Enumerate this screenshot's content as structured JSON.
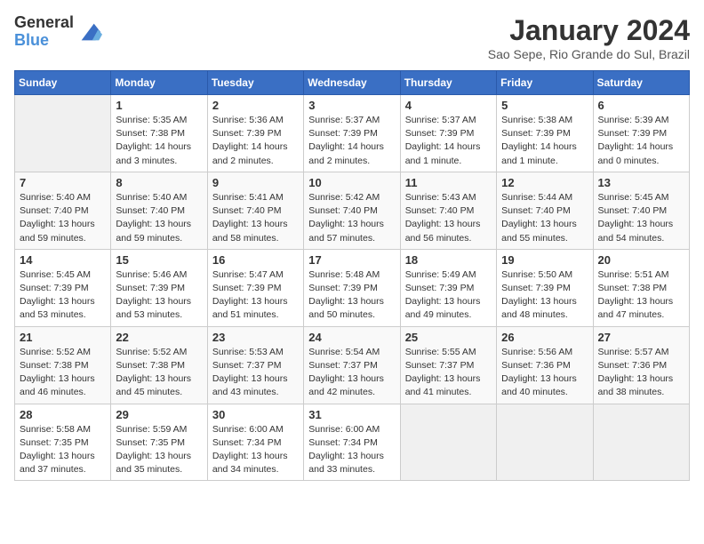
{
  "logo": {
    "general": "General",
    "blue": "Blue"
  },
  "title": "January 2024",
  "subtitle": "Sao Sepe, Rio Grande do Sul, Brazil",
  "days_of_week": [
    "Sunday",
    "Monday",
    "Tuesday",
    "Wednesday",
    "Thursday",
    "Friday",
    "Saturday"
  ],
  "weeks": [
    [
      {
        "day": "",
        "info": ""
      },
      {
        "day": "1",
        "info": "Sunrise: 5:35 AM\nSunset: 7:38 PM\nDaylight: 14 hours\nand 3 minutes."
      },
      {
        "day": "2",
        "info": "Sunrise: 5:36 AM\nSunset: 7:39 PM\nDaylight: 14 hours\nand 2 minutes."
      },
      {
        "day": "3",
        "info": "Sunrise: 5:37 AM\nSunset: 7:39 PM\nDaylight: 14 hours\nand 2 minutes."
      },
      {
        "day": "4",
        "info": "Sunrise: 5:37 AM\nSunset: 7:39 PM\nDaylight: 14 hours\nand 1 minute."
      },
      {
        "day": "5",
        "info": "Sunrise: 5:38 AM\nSunset: 7:39 PM\nDaylight: 14 hours\nand 1 minute."
      },
      {
        "day": "6",
        "info": "Sunrise: 5:39 AM\nSunset: 7:39 PM\nDaylight: 14 hours\nand 0 minutes."
      }
    ],
    [
      {
        "day": "7",
        "info": "Sunrise: 5:40 AM\nSunset: 7:40 PM\nDaylight: 13 hours\nand 59 minutes."
      },
      {
        "day": "8",
        "info": "Sunrise: 5:40 AM\nSunset: 7:40 PM\nDaylight: 13 hours\nand 59 minutes."
      },
      {
        "day": "9",
        "info": "Sunrise: 5:41 AM\nSunset: 7:40 PM\nDaylight: 13 hours\nand 58 minutes."
      },
      {
        "day": "10",
        "info": "Sunrise: 5:42 AM\nSunset: 7:40 PM\nDaylight: 13 hours\nand 57 minutes."
      },
      {
        "day": "11",
        "info": "Sunrise: 5:43 AM\nSunset: 7:40 PM\nDaylight: 13 hours\nand 56 minutes."
      },
      {
        "day": "12",
        "info": "Sunrise: 5:44 AM\nSunset: 7:40 PM\nDaylight: 13 hours\nand 55 minutes."
      },
      {
        "day": "13",
        "info": "Sunrise: 5:45 AM\nSunset: 7:40 PM\nDaylight: 13 hours\nand 54 minutes."
      }
    ],
    [
      {
        "day": "14",
        "info": "Sunrise: 5:45 AM\nSunset: 7:39 PM\nDaylight: 13 hours\nand 53 minutes."
      },
      {
        "day": "15",
        "info": "Sunrise: 5:46 AM\nSunset: 7:39 PM\nDaylight: 13 hours\nand 53 minutes."
      },
      {
        "day": "16",
        "info": "Sunrise: 5:47 AM\nSunset: 7:39 PM\nDaylight: 13 hours\nand 51 minutes."
      },
      {
        "day": "17",
        "info": "Sunrise: 5:48 AM\nSunset: 7:39 PM\nDaylight: 13 hours\nand 50 minutes."
      },
      {
        "day": "18",
        "info": "Sunrise: 5:49 AM\nSunset: 7:39 PM\nDaylight: 13 hours\nand 49 minutes."
      },
      {
        "day": "19",
        "info": "Sunrise: 5:50 AM\nSunset: 7:39 PM\nDaylight: 13 hours\nand 48 minutes."
      },
      {
        "day": "20",
        "info": "Sunrise: 5:51 AM\nSunset: 7:38 PM\nDaylight: 13 hours\nand 47 minutes."
      }
    ],
    [
      {
        "day": "21",
        "info": "Sunrise: 5:52 AM\nSunset: 7:38 PM\nDaylight: 13 hours\nand 46 minutes."
      },
      {
        "day": "22",
        "info": "Sunrise: 5:52 AM\nSunset: 7:38 PM\nDaylight: 13 hours\nand 45 minutes."
      },
      {
        "day": "23",
        "info": "Sunrise: 5:53 AM\nSunset: 7:37 PM\nDaylight: 13 hours\nand 43 minutes."
      },
      {
        "day": "24",
        "info": "Sunrise: 5:54 AM\nSunset: 7:37 PM\nDaylight: 13 hours\nand 42 minutes."
      },
      {
        "day": "25",
        "info": "Sunrise: 5:55 AM\nSunset: 7:37 PM\nDaylight: 13 hours\nand 41 minutes."
      },
      {
        "day": "26",
        "info": "Sunrise: 5:56 AM\nSunset: 7:36 PM\nDaylight: 13 hours\nand 40 minutes."
      },
      {
        "day": "27",
        "info": "Sunrise: 5:57 AM\nSunset: 7:36 PM\nDaylight: 13 hours\nand 38 minutes."
      }
    ],
    [
      {
        "day": "28",
        "info": "Sunrise: 5:58 AM\nSunset: 7:35 PM\nDaylight: 13 hours\nand 37 minutes."
      },
      {
        "day": "29",
        "info": "Sunrise: 5:59 AM\nSunset: 7:35 PM\nDaylight: 13 hours\nand 35 minutes."
      },
      {
        "day": "30",
        "info": "Sunrise: 6:00 AM\nSunset: 7:34 PM\nDaylight: 13 hours\nand 34 minutes."
      },
      {
        "day": "31",
        "info": "Sunrise: 6:00 AM\nSunset: 7:34 PM\nDaylight: 13 hours\nand 33 minutes."
      },
      {
        "day": "",
        "info": ""
      },
      {
        "day": "",
        "info": ""
      },
      {
        "day": "",
        "info": ""
      }
    ]
  ]
}
